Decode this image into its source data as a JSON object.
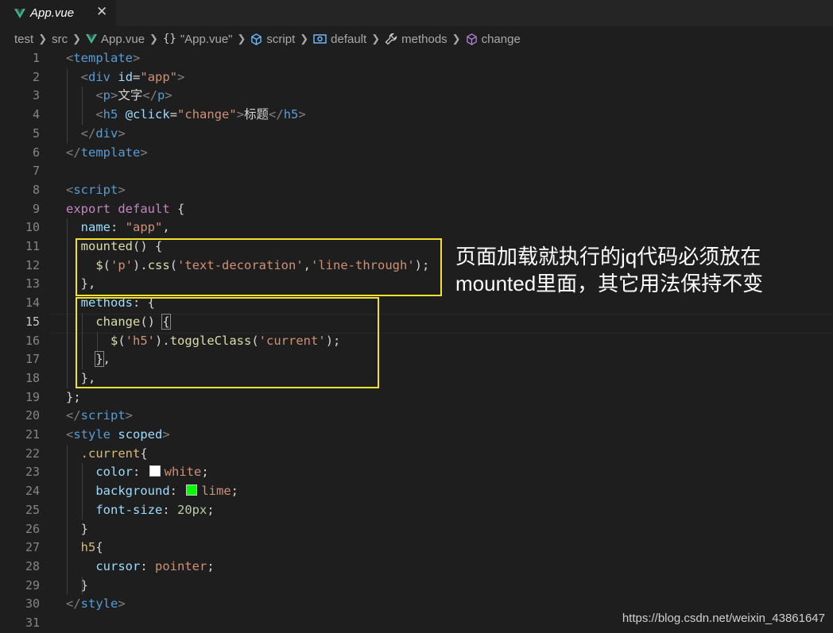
{
  "tab": {
    "label": "App.vue",
    "close": "✕"
  },
  "breadcrumb": [
    "test",
    "src",
    "App.vue",
    "\"App.vue\"",
    "script",
    "default",
    "methods",
    "change"
  ],
  "breadcrumb_icons": [
    "vue-logo-icon",
    "object-braces-icon",
    "box-icon",
    "object-icon",
    "wrench-icon",
    "cube-icon"
  ],
  "colors": {
    "annotation_box": "#f2e02a",
    "white_swatch": "#ffffff",
    "lime_swatch": "#00ff00"
  },
  "line_numbers": [
    "1",
    "2",
    "3",
    "4",
    "5",
    "6",
    "7",
    "8",
    "9",
    "10",
    "11",
    "12",
    "13",
    "14",
    "15",
    "16",
    "17",
    "18",
    "19",
    "20",
    "21",
    "22",
    "23",
    "24",
    "25",
    "26",
    "27",
    "28",
    "29",
    "30",
    "31"
  ],
  "active_line": "15",
  "code": {
    "l1": [
      "<",
      "template",
      ">"
    ],
    "l2": [
      "<",
      "div",
      " ",
      "id",
      "=",
      "\"app\"",
      ">"
    ],
    "l3": [
      "<",
      "p",
      ">",
      "文字",
      "</",
      "p",
      ">"
    ],
    "l4": [
      "<",
      "h5",
      " ",
      "@click",
      "=",
      "\"change\"",
      ">",
      "标题",
      "</",
      "h5",
      ">"
    ],
    "l5": [
      "</",
      "div",
      ">"
    ],
    "l6": [
      "</",
      "template",
      ">"
    ],
    "l8": [
      "<",
      "script",
      ">"
    ],
    "l9": [
      "export",
      " ",
      "default",
      " {"
    ],
    "l10": [
      "name",
      ": ",
      "\"app\"",
      ","
    ],
    "l11": [
      "mounted",
      "() {"
    ],
    "l12": [
      "$",
      "(",
      "'p'",
      ").",
      "css",
      "(",
      "'text-decoration'",
      ",",
      "'line-through'",
      ");"
    ],
    "l13": [
      "},"
    ],
    "l14": [
      "methods",
      ": {"
    ],
    "l15": [
      "change",
      "() ",
      "{"
    ],
    "l16": [
      "$",
      "(",
      "'h5'",
      ").",
      "toggleClass",
      "(",
      "'current'",
      ");"
    ],
    "l17": [
      "}",
      ","
    ],
    "l18": [
      "},"
    ],
    "l19": [
      "};"
    ],
    "l20": [
      "</",
      "script",
      ">"
    ],
    "l21": [
      "<",
      "style",
      " ",
      "scoped",
      ">"
    ],
    "l22": [
      ".current",
      "{"
    ],
    "l23": [
      "color",
      ": ",
      "white",
      ";"
    ],
    "l24": [
      "background",
      ": ",
      "lime",
      ";"
    ],
    "l25": [
      "font-size",
      ": ",
      "20px",
      ";"
    ],
    "l26": [
      "}"
    ],
    "l27": [
      "h5",
      "{"
    ],
    "l28": [
      "cursor",
      ": ",
      "pointer",
      ";"
    ],
    "l29": [
      "}"
    ],
    "l30": [
      "</",
      "style",
      ">"
    ]
  },
  "annotation": [
    "页面加载就执行的jq代码必须放在",
    "mounted里面，其它用法保持不变"
  ],
  "watermark": "https://blog.csdn.net/weixin_43861647"
}
